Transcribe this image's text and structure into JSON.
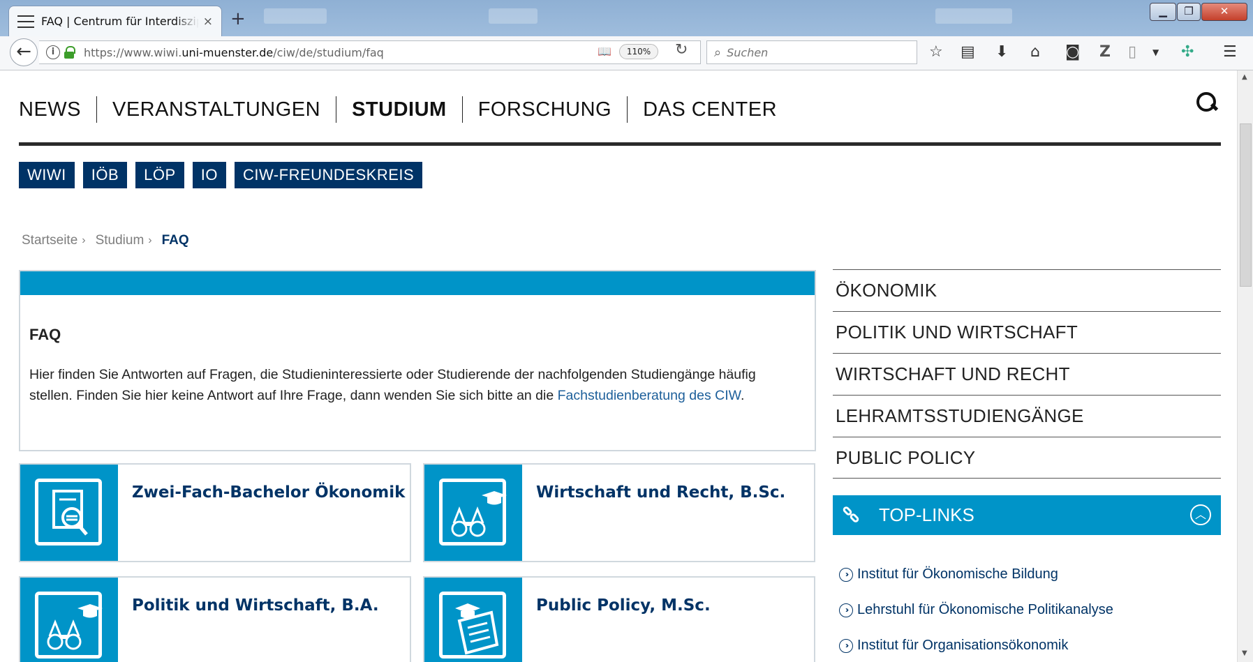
{
  "browser": {
    "tab_title": "FAQ | Centrum für Interdisziplinäre Wirtschaftsforschung",
    "url_prefix": "https://www.wiwi.",
    "url_domain": "uni-muenster.de",
    "url_path": "/ciw/de/studium/faq",
    "zoom": "110%",
    "search_placeholder": "Suchen",
    "tab_close": "×",
    "new_tab": "+"
  },
  "main_nav": [
    "NEWS",
    "VERANSTALTUNGEN",
    "STUDIUM",
    "FORSCHUNG",
    "DAS CENTER"
  ],
  "main_nav_active": "STUDIUM",
  "sub_nav": [
    "WIWI",
    "IÖB",
    "LÖP",
    "IO",
    "CIW-FREUNDESKREIS"
  ],
  "breadcrumb": {
    "items": [
      "Startseite",
      "Studium"
    ],
    "current": "FAQ",
    "separator": "›"
  },
  "faq": {
    "heading": "FAQ",
    "text_before": "Hier finden Sie Antworten auf Fragen, die Studieninteressierte oder Studierende der nachfolgenden Studiengänge häufig stellen. Finden Sie hier keine Antwort auf Ihre Frage, dann wenden Sie sich bitte an die ",
    "link": "Fachstudienberatung des CIW",
    "text_after": "."
  },
  "cards": [
    {
      "title": "Zwei-Fach-Bachelor Ökonomik",
      "icon": "document-magnifier-icon"
    },
    {
      "title": "Wirtschaft und Recht, B.Sc.",
      "icon": "binoculars-graduation-icon"
    },
    {
      "title": "Politik und Wirtschaft, B.A.",
      "icon": "binoculars-graduation-icon"
    },
    {
      "title": "Public Policy, M.Sc.",
      "icon": "diploma-scroll-icon"
    }
  ],
  "side_links": [
    "ÖKONOMIK",
    "POLITIK UND WIRTSCHAFT",
    "WIRTSCHAFT UND RECHT",
    "LEHRAMTSSTUDIENGÄNGE",
    "PUBLIC POLICY"
  ],
  "top_links": {
    "heading": "TOP-LINKS",
    "items": [
      "Institut für Ökonomische Bildung",
      "Lehrstuhl für Ökonomische Politikanalyse",
      "Institut für Organisationsökonomik"
    ]
  },
  "colors": {
    "accent": "#0094c8",
    "navy": "#003366"
  }
}
